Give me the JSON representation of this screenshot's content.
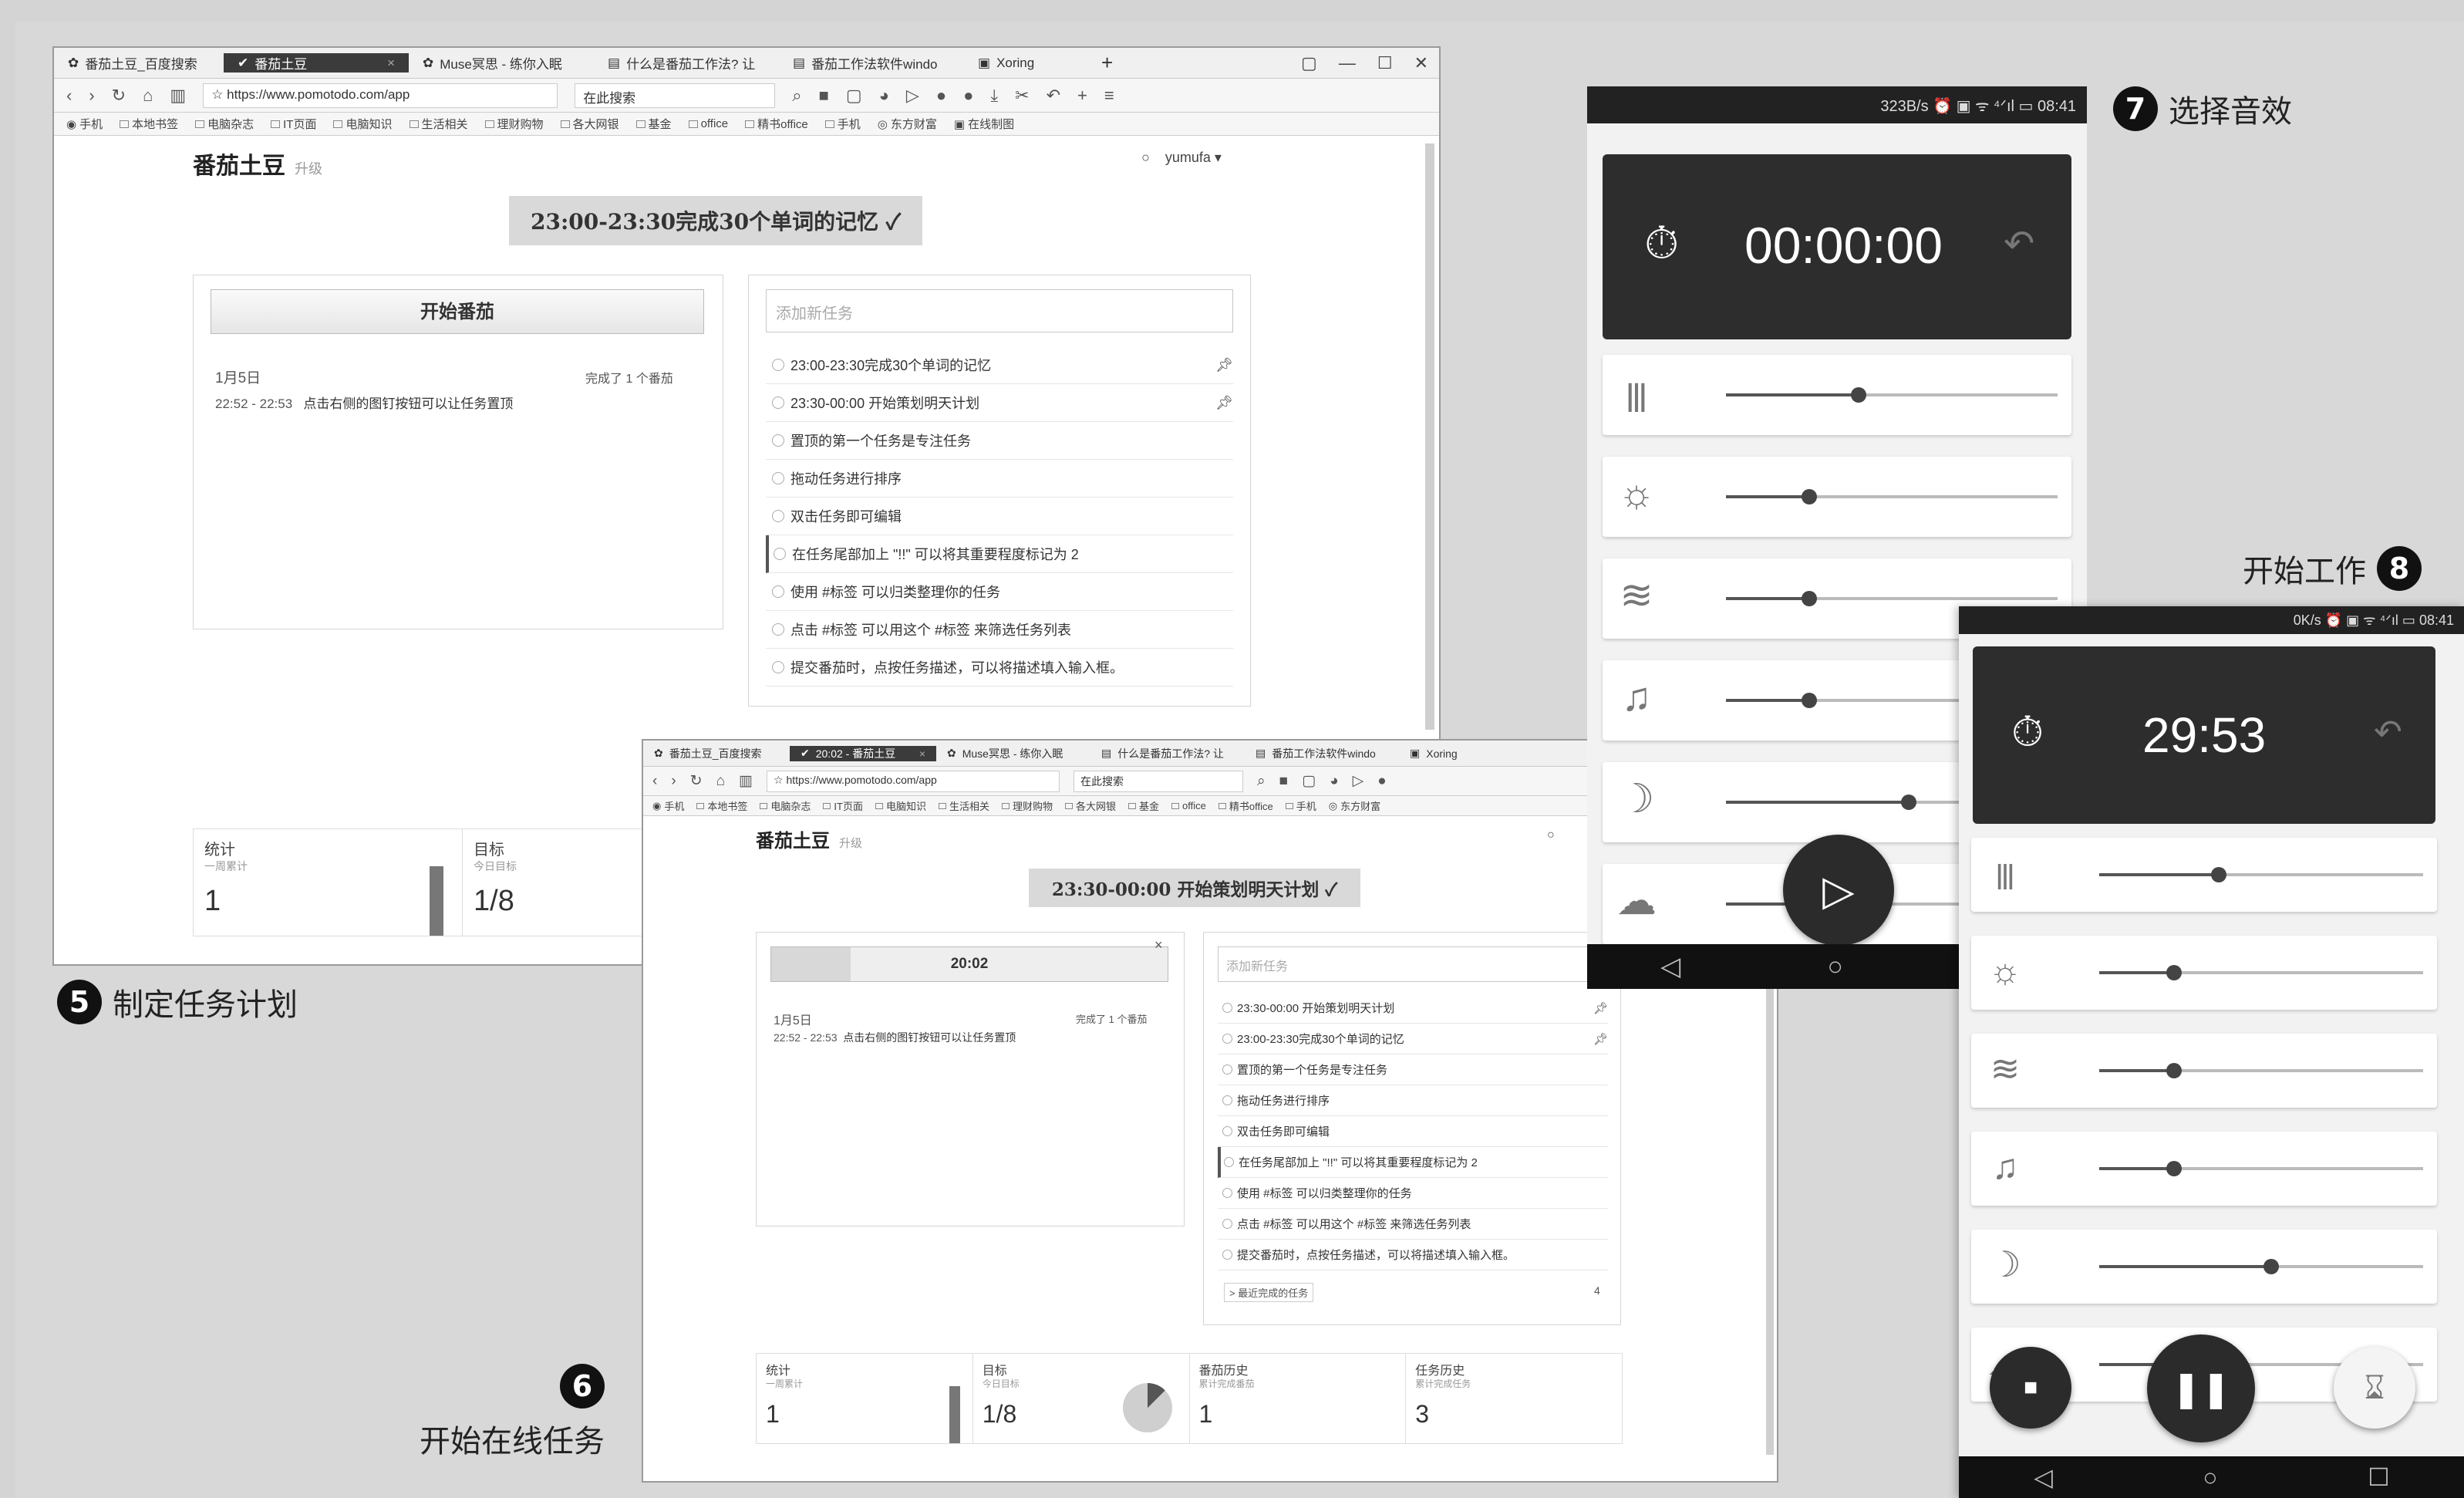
{
  "captions": {
    "c5": "制定任务计划",
    "c6": "开始在线任务",
    "c7": "选择音效",
    "c8": "开始工作",
    "n5": "5",
    "n6": "6",
    "n7": "7",
    "n8": "8"
  },
  "shot1": {
    "tabs": [
      "番茄土豆_百度搜索",
      "番茄土豆",
      "Muse冥思 - 练你入眠",
      "什么是番茄工作法? 让",
      "番茄工作法软件windo",
      "Xoring"
    ],
    "url": "https://www.pomotodo.com/app",
    "search": "在此搜索",
    "bookmarks": [
      "手机",
      "本地书签",
      "电脑杂志",
      "IT页面",
      "电脑知识",
      "生活相关",
      "理财购物",
      "各大网银",
      "基金",
      "office",
      "精书office",
      "手机",
      "东方财富",
      "在线制图"
    ],
    "logo": "番茄土豆",
    "upgrade": "升级",
    "user": "yumufa",
    "banner": "23:00-23:30完成30个单词的记忆 ✓",
    "start": "开始番茄",
    "rec_date": "1月5日",
    "rec_done": "完成了 1 个番茄",
    "rec_time": "22:52 - 22:53",
    "rec_text": "点击右侧的图钉按钮可以让任务置顶",
    "input_ph": "添加新任务",
    "tasks": [
      "23:00-23:30完成30个单词的记忆",
      "23:30-00:00 开始策划明天计划",
      "置顶的第一个任务是专注任务",
      "拖动任务进行排序",
      "双击任务即可编辑",
      "在任务尾部加上 \"!!\" 可以将其重要程度标记为 2",
      "使用 #标签 可以归类整理你的任务",
      "点击 #标签 可以用这个 #标签 来筛选任务列表",
      "提交番茄时，点按任务描述，可以将描述填入输入框。"
    ],
    "stat1_t": "统计",
    "stat1_s": "一周累计",
    "stat1_v": "1",
    "stat2_t": "目标",
    "stat2_s": "今日目标",
    "stat2_v": "1/8"
  },
  "shot2": {
    "tabs": [
      "番茄土豆_百度搜索",
      "20:02 - 番茄土豆",
      "Muse冥思 - 练你入眠",
      "什么是番茄工作法? 让",
      "番茄工作法软件windo",
      "Xoring"
    ],
    "url": "https://www.pomotodo.com/app",
    "search": "在此搜索",
    "bookmarks": [
      "手机",
      "本地书签",
      "电脑杂志",
      "IT页面",
      "电脑知识",
      "生活相关",
      "理财购物",
      "各大网银",
      "基金",
      "office",
      "精书office",
      "手机",
      "东方财富"
    ],
    "logo": "番茄土豆",
    "upgrade": "升级",
    "banner": "23:30-00:00 开始策划明天计划 ✓",
    "timer": "20:02",
    "rec_date": "1月5日",
    "rec_done": "完成了 1 个番茄",
    "rec_time": "22:52 - 22:53",
    "rec_text": "点击右侧的图钉按钮可以让任务置顶",
    "input_ph": "添加新任务",
    "tasks": [
      "23:30-00:00 开始策划明天计划",
      "23:00-23:30完成30个单词的记忆",
      "置顶的第一个任务是专注任务",
      "拖动任务进行排序",
      "双击任务即可编辑",
      "在任务尾部加上 \"!!\" 可以将其重要程度标记为 2",
      "使用 #标签 可以归类整理你的任务",
      "点击 #标签 可以用这个 #标签 来筛选任务列表",
      "提交番茄时，点按任务描述，可以将描述填入输入框。"
    ],
    "done_link": "> 最近完成的任务",
    "done_count": "4",
    "stat1_t": "统计",
    "stat1_s": "一周累计",
    "stat1_v": "1",
    "stat2_t": "目标",
    "stat2_s": "今日目标",
    "stat2_v": "1/8",
    "stat3_t": "番茄历史",
    "stat3_s": "累计完成番茄",
    "stat3_v": "1",
    "stat4_t": "任务历史",
    "stat4_s": "累计完成任务",
    "stat4_v": "3",
    "goal_fraction": 0.125
  },
  "phone1": {
    "status": "323B/s ⏰ ▣ ᯤ ⁴ᐟıl ▭ 08:41",
    "time": "00:00:00",
    "levels": [
      0.4,
      0.25,
      0.25,
      0.25,
      0.55,
      0.25
    ]
  },
  "phone2": {
    "status": "0K/s ⏰ ▣ ᯤ ⁴ᐟıl ▭ 08:41",
    "time": "29:53",
    "levels": [
      0.37,
      0.23,
      0.23,
      0.23,
      0.53,
      0.23
    ]
  }
}
